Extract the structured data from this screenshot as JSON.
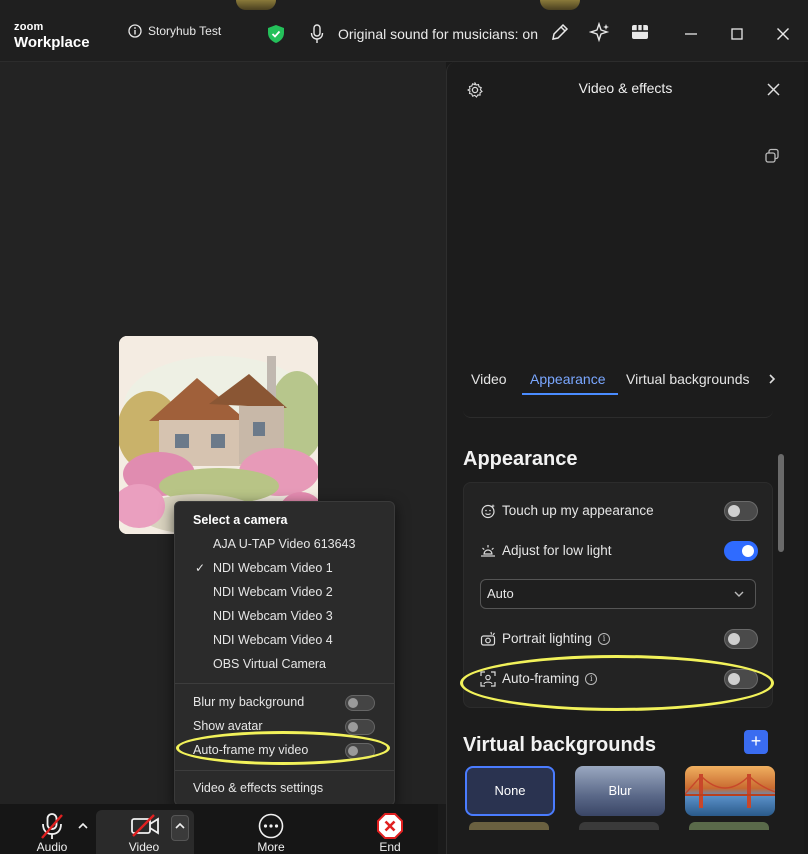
{
  "titlebar": {
    "logo_small": "zoom",
    "logo_large": "Workplace",
    "meeting_name": "Storyhub Test",
    "original_sound": "Original sound for musicians: on"
  },
  "camera_menu": {
    "title": "Select a camera",
    "cameras": [
      {
        "label": "AJA U-TAP Video 613643",
        "selected": false
      },
      {
        "label": "NDI Webcam Video 1",
        "selected": true
      },
      {
        "label": "NDI Webcam Video 2",
        "selected": false
      },
      {
        "label": "NDI Webcam Video 3",
        "selected": false
      },
      {
        "label": "NDI Webcam Video 4",
        "selected": false
      },
      {
        "label": "OBS Virtual Camera",
        "selected": false
      }
    ],
    "checkmark": "✓",
    "options": [
      {
        "label": "Blur my background",
        "on": false
      },
      {
        "label": "Show avatar",
        "on": false
      },
      {
        "label": "Auto-frame my video",
        "on": false
      }
    ],
    "settings_link": "Video & effects settings"
  },
  "toolbar": {
    "audio_label": "Audio",
    "video_label": "Video",
    "more_label": "More",
    "end_label": "End"
  },
  "panel": {
    "title": "Video & effects",
    "tabs": [
      "Video",
      "Appearance",
      "Virtual backgrounds"
    ],
    "active_tab": "Appearance",
    "appearance_heading": "Appearance",
    "rows": {
      "touch_up": {
        "label": "Touch up my appearance",
        "on": false
      },
      "low_light": {
        "label": "Adjust for low light",
        "on": true
      },
      "low_light_mode": "Auto",
      "portrait": {
        "label": "Portrait lighting",
        "on": false
      },
      "auto_framing": {
        "label": "Auto-framing",
        "on": false
      }
    },
    "vb_heading": "Virtual backgrounds",
    "vb_add": "+",
    "backgrounds": [
      "None",
      "Blur",
      ""
    ]
  },
  "colors": {
    "accent": "#2f6bff",
    "highlight": "#f2f25a",
    "end_red": "#e02020"
  }
}
